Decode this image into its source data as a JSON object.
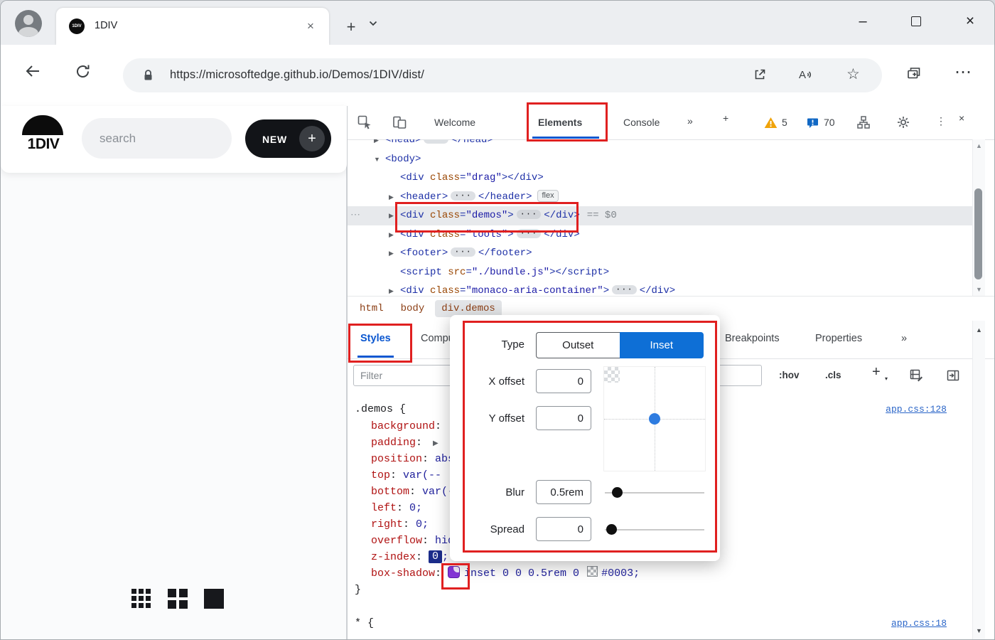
{
  "window": {
    "tab_title": "1DIV",
    "favicon_text": "1DIV",
    "close_tab": "×",
    "new_tab": "+",
    "minimize": "–",
    "close_window": "×"
  },
  "navbar": {
    "url": "https://microsoftedge.github.io/Demos/1DIV/dist/"
  },
  "page": {
    "logo_text": "1DIV",
    "search_placeholder": "search",
    "new_button_label": "NEW",
    "new_button_plus": "+"
  },
  "devtools": {
    "toolbar": {
      "welcome": "Welcome",
      "elements": "Elements",
      "console": "Console",
      "more_tabs": "»",
      "add_tab": "+",
      "warning_count": "5",
      "issues_count": "70",
      "kebab": "⋮",
      "close": "×"
    },
    "dom": {
      "ellipsis": "···",
      "row_dots": "⋯",
      "flex_badge": "flex",
      "selected_hint": "== $0",
      "lines": [
        {
          "indent": 1,
          "arrow": "right",
          "segs": [
            [
              "p",
              "<"
            ],
            [
              "t",
              "head"
            ],
            [
              "p",
              ">"
            ],
            [
              "dots"
            ],
            [
              "p",
              "</"
            ],
            [
              "t",
              "head"
            ],
            [
              "p",
              ">"
            ]
          ]
        },
        {
          "indent": 1,
          "arrow": "down",
          "segs": [
            [
              "p",
              "<"
            ],
            [
              "t",
              "body"
            ],
            [
              "p",
              ">"
            ]
          ]
        },
        {
          "indent": 2,
          "segs": [
            [
              "p",
              "<"
            ],
            [
              "t",
              "div"
            ],
            [
              "plain",
              " "
            ],
            [
              "a",
              "class"
            ],
            [
              "p",
              "="
            ],
            [
              "v",
              "\"drag\""
            ],
            [
              "p",
              ">"
            ],
            [
              "p",
              "</"
            ],
            [
              "t",
              "div"
            ],
            [
              "p",
              ">"
            ]
          ]
        },
        {
          "indent": 2,
          "arrow": "right",
          "badge": "flex",
          "segs": [
            [
              "p",
              "<"
            ],
            [
              "t",
              "header"
            ],
            [
              "p",
              ">"
            ],
            [
              "dots"
            ],
            [
              "p",
              "</"
            ],
            [
              "t",
              "header"
            ],
            [
              "p",
              ">"
            ]
          ]
        },
        {
          "indent": 2,
          "arrow": "right",
          "selected": true,
          "leftdots": true,
          "suffix": "== $0",
          "segs": [
            [
              "p",
              "<"
            ],
            [
              "t",
              "div"
            ],
            [
              "plain",
              " "
            ],
            [
              "a",
              "class"
            ],
            [
              "p",
              "="
            ],
            [
              "v",
              "\"demos\""
            ],
            [
              "p",
              ">"
            ],
            [
              "dots"
            ],
            [
              "p",
              "</"
            ],
            [
              "t",
              "div"
            ],
            [
              "p",
              ">"
            ]
          ]
        },
        {
          "indent": 2,
          "arrow": "right",
          "segs": [
            [
              "p",
              "<"
            ],
            [
              "t",
              "div"
            ],
            [
              "plain",
              " "
            ],
            [
              "a",
              "class"
            ],
            [
              "p",
              "="
            ],
            [
              "v",
              "\"tools\""
            ],
            [
              "p",
              ">"
            ],
            [
              "dots"
            ],
            [
              "p",
              "</"
            ],
            [
              "t",
              "div"
            ],
            [
              "p",
              ">"
            ]
          ]
        },
        {
          "indent": 2,
          "arrow": "right",
          "segs": [
            [
              "p",
              "<"
            ],
            [
              "t",
              "footer"
            ],
            [
              "p",
              ">"
            ],
            [
              "dots"
            ],
            [
              "p",
              "</"
            ],
            [
              "t",
              "footer"
            ],
            [
              "p",
              ">"
            ]
          ]
        },
        {
          "indent": 2,
          "segs": [
            [
              "p",
              "<"
            ],
            [
              "t",
              "script"
            ],
            [
              "plain",
              " "
            ],
            [
              "a",
              "src"
            ],
            [
              "p",
              "="
            ],
            [
              "v",
              "\"./bundle.js\""
            ],
            [
              "p",
              ">"
            ],
            [
              "p",
              "</"
            ],
            [
              "t",
              "script"
            ],
            [
              "p",
              ">"
            ]
          ]
        },
        {
          "indent": 2,
          "arrow": "right",
          "segs": [
            [
              "p",
              "<"
            ],
            [
              "t",
              "div"
            ],
            [
              "plain",
              " "
            ],
            [
              "a",
              "class"
            ],
            [
              "p",
              "="
            ],
            [
              "v",
              "\"monaco-aria-container\""
            ],
            [
              "p",
              ">"
            ],
            [
              "dots"
            ],
            [
              "p",
              "</"
            ],
            [
              "t",
              "div"
            ],
            [
              "p",
              ">"
            ]
          ]
        }
      ]
    },
    "breadcrumbs": [
      {
        "label": "html",
        "selected": false
      },
      {
        "label": "body",
        "selected": false
      },
      {
        "label": "div.demos",
        "selected": true
      }
    ],
    "sidebar_tabs": [
      {
        "label": "Styles",
        "active": true
      },
      {
        "label": "Computed",
        "active": false
      },
      {
        "label": "Breakpoints",
        "active": false
      },
      {
        "label": "Properties",
        "active": false
      },
      {
        "label": "»",
        "active": false
      }
    ],
    "filter_placeholder": "Filter",
    "toggles": {
      "hover": ":hov",
      "classes": ".cls",
      "new_rule": "+"
    },
    "rules": [
      {
        "selector": ".demos {",
        "link": "app.css:128",
        "close": "}",
        "props": [
          {
            "segs": [
              [
                "prop",
                "background"
              ],
              [
                "plain",
                ": "
              ]
            ]
          },
          {
            "segs": [
              [
                "prop",
                "padding"
              ],
              [
                "plain",
                ": "
              ],
              [
                "arrow"
              ]
            ]
          },
          {
            "segs": [
              [
                "prop",
                "position"
              ],
              [
                "plain",
                ": "
              ],
              [
                "val",
                "abso"
              ]
            ]
          },
          {
            "segs": [
              [
                "prop",
                "top"
              ],
              [
                "plain",
                ": "
              ],
              [
                "val",
                "var(--"
              ]
            ]
          },
          {
            "segs": [
              [
                "prop",
                "bottom"
              ],
              [
                "plain",
                ": "
              ],
              [
                "val",
                "var(--"
              ]
            ]
          },
          {
            "segs": [
              [
                "prop",
                "left"
              ],
              [
                "plain",
                ": "
              ],
              [
                "val",
                "0;"
              ]
            ]
          },
          {
            "segs": [
              [
                "prop",
                "right"
              ],
              [
                "plain",
                ": "
              ],
              [
                "val",
                "0;"
              ]
            ]
          },
          {
            "segs": [
              [
                "prop",
                "overflow"
              ],
              [
                "plain",
                ": "
              ],
              [
                "val",
                "hid"
              ]
            ]
          },
          {
            "segs": [
              [
                "prop",
                "z-index"
              ],
              [
                "plain",
                ": "
              ],
              [
                "chip",
                "0"
              ],
              [
                "val",
                ";"
              ]
            ]
          },
          {
            "segs": [
              [
                "prop",
                "box-shadow"
              ],
              [
                "plain",
                ": "
              ],
              [
                "shadowicon"
              ],
              [
                "val",
                "inset 0 0 0.5rem 0 "
              ],
              [
                "checker"
              ],
              [
                "val",
                "#0003;"
              ]
            ]
          }
        ]
      },
      {
        "selector": "* {",
        "link": "app.css:18",
        "props": []
      }
    ]
  },
  "shadow_editor": {
    "type_label": "Type",
    "outset_label": "Outset",
    "inset_label": "Inset",
    "x_label": "X offset",
    "x_value": "0",
    "y_label": "Y offset",
    "y_value": "0",
    "blur_label": "Blur",
    "blur_value": "0.5rem",
    "spread_label": "Spread",
    "spread_value": "0"
  },
  "colors": {
    "accent": "#0b57d0",
    "annotation": "#e02020",
    "inset_button": "#0e6fd6"
  }
}
